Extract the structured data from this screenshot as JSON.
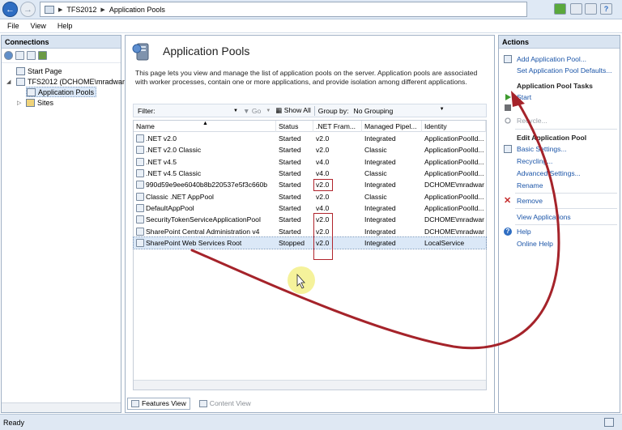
{
  "address": {
    "segments": [
      "TFS2012",
      "Application Pools"
    ]
  },
  "menu": [
    "File",
    "View",
    "Help"
  ],
  "connections": {
    "title": "Connections",
    "tree": [
      {
        "label": "Start Page"
      },
      {
        "label": "TFS2012 (DCHOME\\mradwan"
      },
      {
        "label": "Application Pools"
      },
      {
        "label": "Sites"
      }
    ]
  },
  "main": {
    "title": "Application Pools",
    "description": "This page lets you view and manage the list of application pools on the server. Application pools are associated with worker processes, contain one or more applications, and provide isolation among different applications.",
    "filter": {
      "label": "Filter:",
      "go": "Go",
      "show_all": "Show All",
      "group_by_label": "Group by:",
      "group_by_value": "No Grouping"
    },
    "columns": [
      "Name",
      "Status",
      ".NET Fram...",
      "Managed Pipel...",
      "Identity"
    ],
    "rows": [
      {
        "name": ".NET v2.0",
        "status": "Started",
        "net": "v2.0",
        "pipeline": "Integrated",
        "identity": "ApplicationPoolId..."
      },
      {
        "name": ".NET v2.0 Classic",
        "status": "Started",
        "net": "v2.0",
        "pipeline": "Classic",
        "identity": "ApplicationPoolId..."
      },
      {
        "name": ".NET v4.5",
        "status": "Started",
        "net": "v4.0",
        "pipeline": "Integrated",
        "identity": "ApplicationPoolId..."
      },
      {
        "name": ".NET v4.5 Classic",
        "status": "Started",
        "net": "v4.0",
        "pipeline": "Classic",
        "identity": "ApplicationPoolId..."
      },
      {
        "name": "990d59e9ee6040b8b220537e5f3c660b",
        "status": "Started",
        "net": "v2.0",
        "pipeline": "Integrated",
        "identity": "DCHOME\\mradwar"
      },
      {
        "name": "Classic .NET AppPool",
        "status": "Started",
        "net": "v2.0",
        "pipeline": "Classic",
        "identity": "ApplicationPoolId..."
      },
      {
        "name": "DefaultAppPool",
        "status": "Started",
        "net": "v4.0",
        "pipeline": "Integrated",
        "identity": "ApplicationPoolId..."
      },
      {
        "name": "SecurityTokenServiceApplicationPool",
        "status": "Started",
        "net": "v2.0",
        "pipeline": "Integrated",
        "identity": "DCHOME\\mradwar"
      },
      {
        "name": "SharePoint Central Administration v4",
        "status": "Started",
        "net": "v2.0",
        "pipeline": "Integrated",
        "identity": "DCHOME\\mradwar"
      },
      {
        "name": "SharePoint Web Services Root",
        "status": "Stopped",
        "net": "v2.0",
        "pipeline": "Integrated",
        "identity": "LocalService"
      }
    ],
    "tabs": {
      "features": "Features View",
      "content": "Content View"
    }
  },
  "actions": {
    "title": "Actions",
    "add": "Add Application Pool...",
    "defaults": "Set Application Pool Defaults...",
    "tasks_header": "Application Pool Tasks",
    "start": "Start",
    "recycle": "Recycle...",
    "edit_header": "Edit Application Pool",
    "basic": "Basic Settings...",
    "recycling": "Recycling...",
    "advanced": "Advanced Settings...",
    "rename": "Rename",
    "remove": "Remove",
    "view_apps": "View Applications",
    "help": "Help",
    "online_help": "Online Help"
  },
  "status": {
    "text": "Ready"
  },
  "colors": {
    "annotation": "#a5232a",
    "link": "#1b55a8",
    "cursor_highlight": "#f3f08a"
  }
}
